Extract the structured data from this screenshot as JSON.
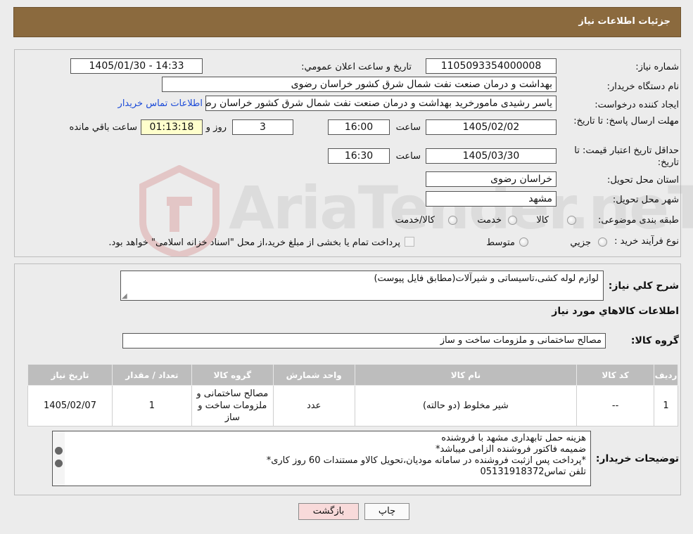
{
  "header": {
    "title": "جزئیات اطلاعات نیاز"
  },
  "form": {
    "need_number": {
      "label": "شماره نیاز:",
      "value": "1105093354000008"
    },
    "announce": {
      "label": "تاریخ و ساعت اعلان عمومي:",
      "value": "1405/01/30 - 14:33"
    },
    "buyer_org": {
      "label": "نام دستگاه خریدار:",
      "value": "بهداشت و درمان صنعت نفت شمال شرق کشور   خراسان رضوی"
    },
    "requester": {
      "label": "ایجاد کننده درخواست:",
      "value": "یاسر رشیدی مامورخرید بهداشت و درمان صنعت نفت شمال شرق کشور   خراسان رضوی",
      "contact_link": "اطلاعات تماس خریدار"
    },
    "deadline": {
      "label": "مهلت ارسال پاسخ: تا تاریخ:",
      "date": "1405/02/02",
      "time_label": "ساعت",
      "time": "16:00",
      "days": "3",
      "days_label": "روز و",
      "remaining": "01:13:18",
      "remaining_label": "ساعت باقي مانده"
    },
    "validity": {
      "label": "حداقل تاریخ اعتبار قیمت: تا تاریخ:",
      "date": "1405/03/30",
      "time_label": "ساعت",
      "time": "16:30"
    },
    "province": {
      "label": "استان محل تحویل:",
      "value": "خراسان رضوی"
    },
    "city": {
      "label": "شهر محل تحویل:",
      "value": "مشهد"
    },
    "category": {
      "label": "طبقه بندی موضوعی:",
      "options": [
        "کالا",
        "خدمت",
        "کالا/خدمت"
      ]
    },
    "purchase_type": {
      "label": "نوع فرآیند خرید :",
      "options": [
        "جزیي",
        "متوسط"
      ],
      "note": "پرداخت تمام یا بخشی از مبلغ خرید،از محل \"اسناد خزانه اسلامی\" خواهد بود."
    }
  },
  "details": {
    "summary_label": "شرح کلي نیاز:",
    "summary_value": "لوازم لوله کشی،تاسیساتی و شیرآلات(مطابق فایل پیوست)",
    "goods_info_title": "اطلاعات کالاهاي مورد نیاز",
    "goods_group_label": "گروه کالا:",
    "goods_group_value": "مصالح ساختمانی و ملزومات ساخت و ساز",
    "table": {
      "headers": [
        "ردیف",
        "کد کالا",
        "نام کالا",
        "واحد شمارش",
        "گروه کالا",
        "تعداد / مقدار",
        "تاریخ نیاز"
      ],
      "rows": [
        [
          "1",
          "--",
          "شیر مخلوط (دو حالته)",
          "عدد",
          "مصالح ساختمانی و ملزومات ساخت و ساز",
          "1",
          "1405/02/07"
        ]
      ]
    },
    "buyer_notes_label": "توضیحات خریدار:",
    "buyer_notes": [
      "هزینه حمل تابهداری مشهد با فروشنده",
      "ضمیمه فاکتور فروشنده الزامی میباشد*",
      "*پرداخت پس ازثبت فروشنده در سامانه مودیان،تحویل کالاو مستندات 60 روز کاری*",
      "تلفن تماس05131918372"
    ]
  },
  "buttons": {
    "print": "چاپ",
    "back": "بازگشت"
  },
  "watermark": {
    "text": "AriaTender.neT"
  },
  "colors": {
    "header_bg": "#8b6a3e",
    "link": "#1c4bd8",
    "table_header": "#bdbdbd",
    "back_button_bg": "#f8dada"
  }
}
